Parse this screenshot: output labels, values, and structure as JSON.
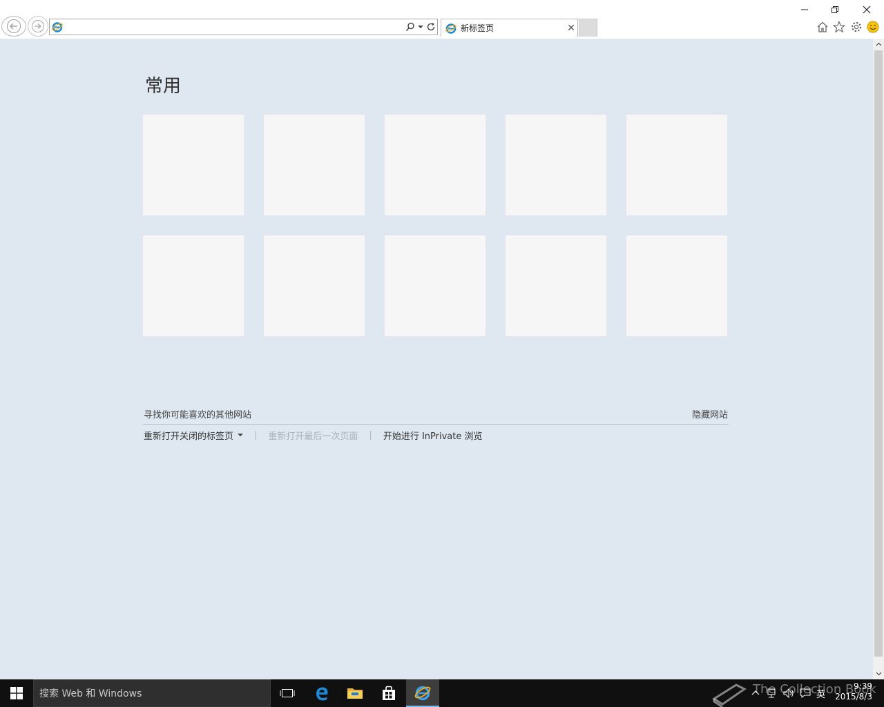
{
  "browser": {
    "address_value": "",
    "tab_title": "新标签页"
  },
  "newtab": {
    "section_title": "常用",
    "tiles_row1": [
      "",
      "",
      "",
      "",
      ""
    ],
    "tiles_row2": [
      "",
      "",
      "",
      "",
      ""
    ],
    "find_sites": "寻找你可能喜欢的其他网站",
    "hide_sites": "隐藏网站",
    "reopen_closed": "重新打开关闭的标签页",
    "reopen_last": "重新打开最后一次页面",
    "inprivate": "开始进行 InPrivate 浏览"
  },
  "taskbar": {
    "search_placeholder": "搜索 Web 和 Windows",
    "ime": "英",
    "time": "9:39",
    "date": "2015/8/3",
    "watermark": "The Collection Book"
  },
  "colors": {
    "page_bg": "#dfe8f1",
    "tile_bg": "#f6f6f6",
    "taskbar_bg": "#101010",
    "ie_blue": "#1e88d2",
    "ie_gold": "#f2b01e"
  },
  "icons": [
    "back-arrow-icon",
    "forward-arrow-icon",
    "ie-logo-icon",
    "search-icon",
    "dropdown-icon",
    "refresh-icon",
    "home-icon",
    "favorites-star-icon",
    "settings-gear-icon",
    "feedback-smiley-icon",
    "windows-logo-icon",
    "task-view-icon",
    "edge-icon",
    "file-explorer-icon",
    "store-icon"
  ]
}
